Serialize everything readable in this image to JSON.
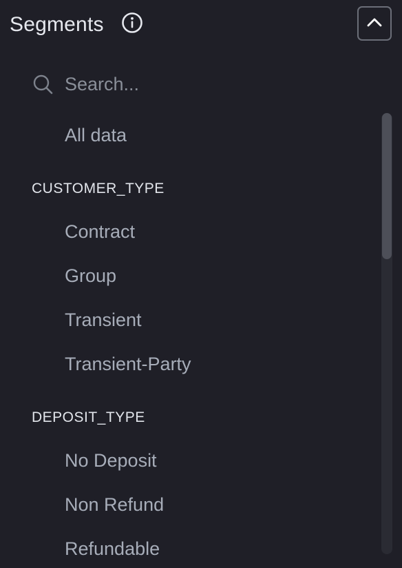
{
  "header": {
    "title": "Segments"
  },
  "search": {
    "placeholder": "Search..."
  },
  "list": {
    "all_data": "All data",
    "groups": [
      {
        "label": "CUSTOMER_TYPE",
        "items": [
          "Contract",
          "Group",
          "Transient",
          "Transient-Party"
        ]
      },
      {
        "label": "DEPOSIT_TYPE",
        "items": [
          "No Deposit",
          "Non Refund",
          "Refundable"
        ]
      }
    ]
  },
  "icons": {
    "info": "info-icon",
    "collapse": "chevron-up-icon",
    "search": "search-icon"
  },
  "colors": {
    "background": "#1f1f27",
    "title": "#e6e8ee",
    "item_text": "#a7adb9",
    "group_label": "#e2e5eb",
    "border": "#6b6e78"
  }
}
